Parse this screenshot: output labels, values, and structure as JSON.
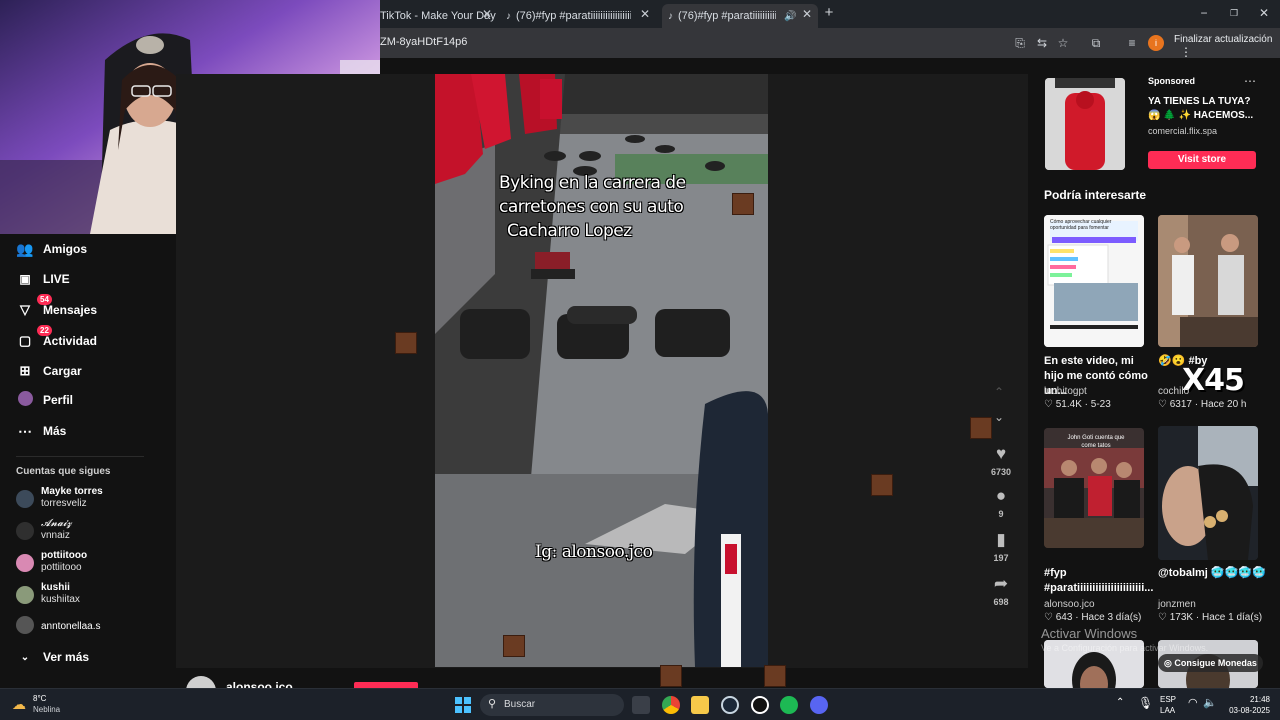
{
  "browser": {
    "tabs": [
      {
        "title": "TikTok - Make Your Day"
      },
      {
        "title": "(76)#fyp #paratiiiiiiiiiiiiiiiiii"
      },
      {
        "title": "(76)#fyp #paratiiiiiiiiiiiiiiii"
      }
    ],
    "url": "ZM-8yaHDtF14p6",
    "update_button": "Finalizar actualización"
  },
  "sidebar": {
    "nav": [
      {
        "label": "Amigos",
        "icon": "friends-icon"
      },
      {
        "label": "LIVE",
        "icon": "live-icon"
      },
      {
        "label": "Mensajes",
        "icon": "messages-icon",
        "badge": "54"
      },
      {
        "label": "Actividad",
        "icon": "activity-icon",
        "badge": "22"
      },
      {
        "label": "Cargar",
        "icon": "upload-icon"
      },
      {
        "label": "Perfil",
        "icon": "profile-icon"
      },
      {
        "label": "Más",
        "icon": "more-icon"
      }
    ],
    "following_header": "Cuentas que sigues",
    "following": [
      {
        "name": "Mayke torres",
        "handle": "torresveliz"
      },
      {
        "name": "𝓐𝓷𝓪𝓲𝔃",
        "handle": "vnnaiz"
      },
      {
        "name": "pottiitooo",
        "handle": "pottiitooo"
      },
      {
        "name": "kushii",
        "handle": "kushiitax"
      },
      {
        "name": "anntonellaa.s",
        "handle": ""
      }
    ],
    "see_more": "Ver más"
  },
  "video": {
    "caption": [
      "Byking en la carrera de",
      "carretones con su auto",
      "Cacharro Lopez"
    ],
    "watermark": "Ig: alonsoo.jco",
    "author": "alonsoo.jco",
    "actions": {
      "likes": "6730",
      "comments": "9",
      "saves": "197",
      "shares": "698"
    }
  },
  "sponsored": {
    "label": "Sponsored",
    "title": "YA TIENES LA TUYA?",
    "subtitle": "😱 🌲 ✨ HACEMOS...",
    "domain": "comercial.flix.spa",
    "button": "Visit store",
    "more": "⋯"
  },
  "recommend": {
    "header": "Podría interesarte",
    "items": [
      {
        "title": "En este video, mi hijo me contó cómo un...",
        "author": "luchitogpt",
        "likes": "51.4K",
        "age": "5-23"
      },
      {
        "title": "🤣😮 #byk",
        "author": "cochilo",
        "likes": "6317",
        "age": "Hace 20 h"
      },
      {
        "title": "#fyp #paratiiiiiiiiiiiiiiiiiiiiii...",
        "author": "alonsoo.jco",
        "likes": "643",
        "age": "Hace 3 día(s)"
      },
      {
        "title": "@tobalmj 🥶🥶🥶🥶",
        "author": "jonzmen",
        "likes": "173K",
        "age": "Hace 1 día(s)"
      }
    ],
    "x45": "X45",
    "thumb1_text": "Cómo aprovechar cualquier oportunidad para fomentar",
    "thumb3_text": "John Goti cuenta que come tatos"
  },
  "activate": {
    "title": "Activar Windows",
    "sub": "Ve a Configuración para activar Windows."
  },
  "coins": "Consigue Monedas",
  "taskbar": {
    "weather_temp": "8°C",
    "weather_desc": "Neblina",
    "search": "Buscar",
    "lang1": "ESP",
    "lang2": "LAA",
    "time": "21:48",
    "date": "03-08-2025"
  },
  "colors": {
    "accent": "#fe2c55",
    "bg": "#121212"
  }
}
